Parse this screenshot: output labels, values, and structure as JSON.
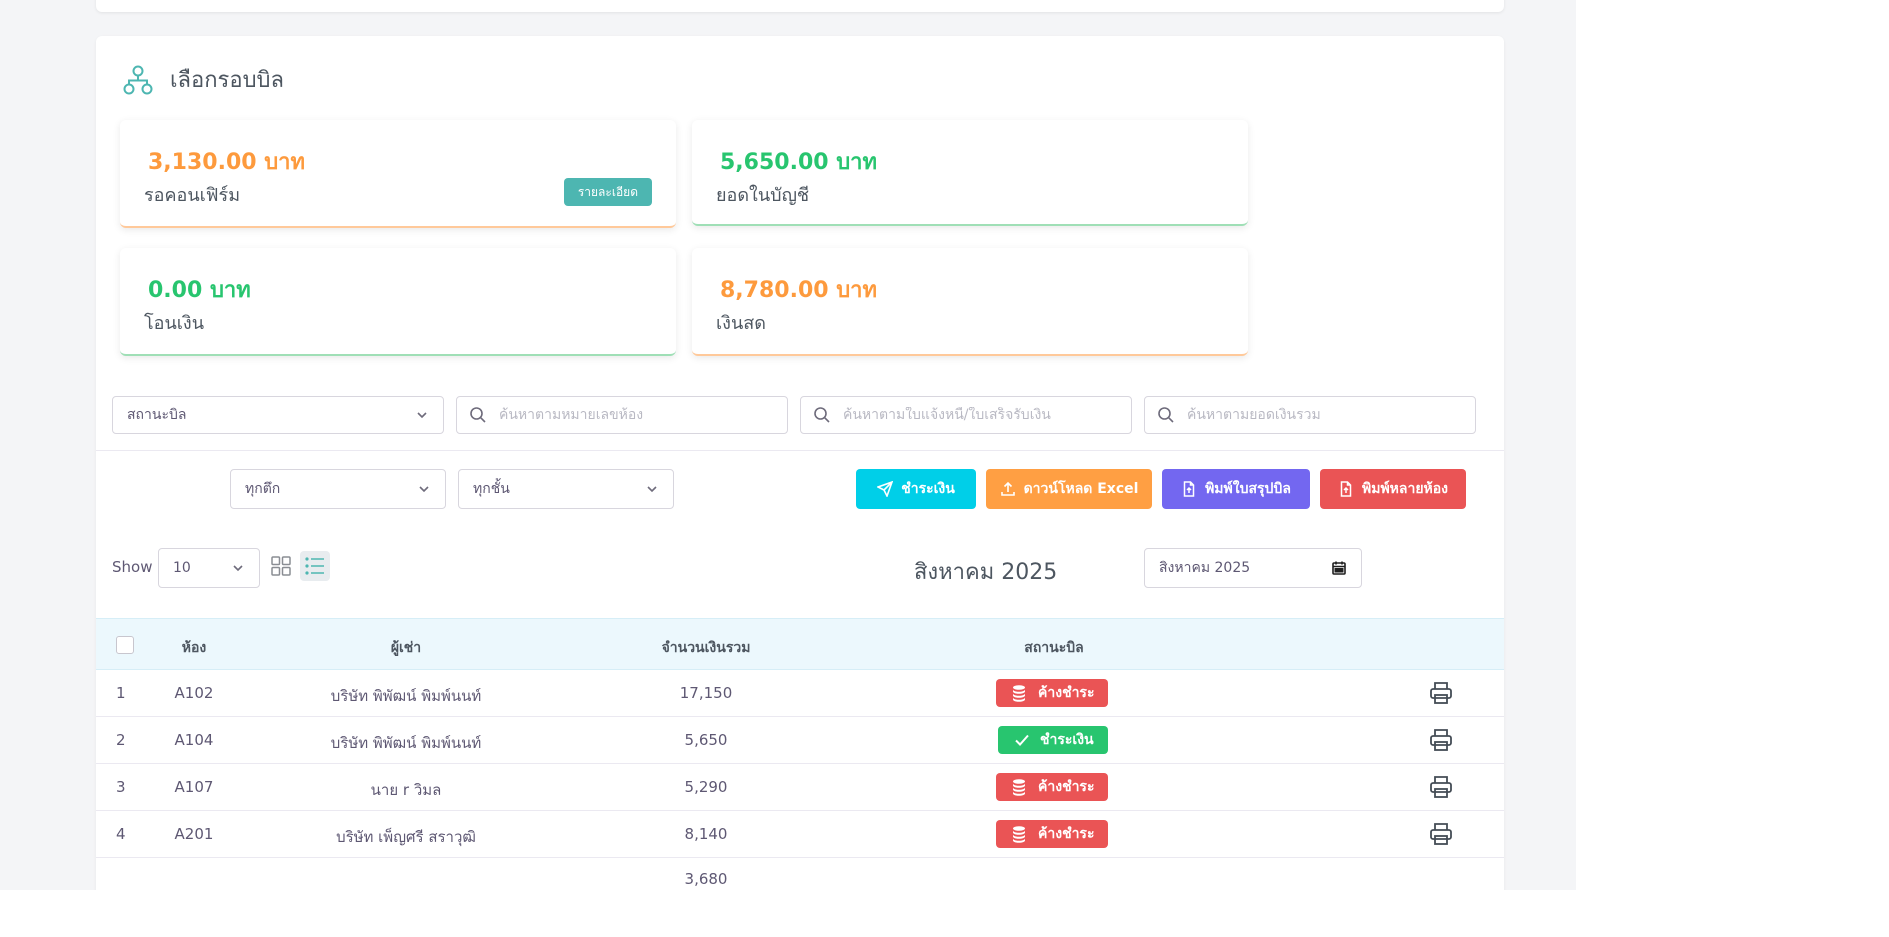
{
  "panel": {
    "title": "เลือกรอบบิล"
  },
  "stats": [
    {
      "amount": "3,130.00 บาท",
      "label": "รอคอนเฟิร์ม",
      "button": "รายละเอียด"
    },
    {
      "amount": "5,650.00 บาท",
      "label": "ยอดในบัญชี"
    },
    {
      "amount": "0.00 บาท",
      "label": "โอนเงิน"
    },
    {
      "amount": "8,780.00 บาท",
      "label": "เงินสด"
    }
  ],
  "filters": {
    "status_select": "สถานะบิล",
    "search_room_placeholder": "ค้นหาตามหมายเลขห้อง",
    "search_invoice_placeholder": "ค้นหาตามใบแจ้งหนี้/ใบเสร็จรับเงิน",
    "search_total_placeholder": "ค้นหาตามยอดเงินรวม",
    "building_select": "ทุกตึก",
    "floor_select": "ทุกชั้น"
  },
  "actions": {
    "pay": "ชำระเงิน",
    "download_excel": "ดาวน์โหลด Excel",
    "print_summary": "พิมพ์ใบสรุปบิล",
    "print_multi": "พิมพ์หลายห้อง"
  },
  "colors": {
    "pay": "#00cfe8",
    "download_excel": "#ff9f43",
    "print_summary": "#7367f0",
    "print_multi": "#ea5455",
    "accent": "#4db6b1"
  },
  "toolbar": {
    "show_label": "Show",
    "page_size": "10",
    "month_title": "สิงหาคม 2025",
    "date_value": "สิงหาคม 2025"
  },
  "table": {
    "headers": {
      "room": "ห้อง",
      "tenant": "ผู้เช่า",
      "total": "จำนวนเงินรวม",
      "status": "สถานะบิล"
    },
    "rows": [
      {
        "no": "1",
        "room": "A102",
        "tenant": "บริษัท พิพัฒน์ พิมพ์นนท์",
        "total": "17,150",
        "status": "ค้างชำระ",
        "status_type": "unpaid"
      },
      {
        "no": "2",
        "room": "A104",
        "tenant": "บริษัท พิพัฒน์ พิมพ์นนท์",
        "total": "5,650",
        "status": "ชำระเงิน",
        "status_type": "paid"
      },
      {
        "no": "3",
        "room": "A107",
        "tenant": "นาย r วิมล",
        "total": "5,290",
        "status": "ค้างชำระ",
        "status_type": "unpaid"
      },
      {
        "no": "4",
        "room": "A201",
        "tenant": "บริษัท เพ็ญศรี สราวุฒิ",
        "total": "8,140",
        "status": "ค้างชำระ",
        "status_type": "unpaid"
      },
      {
        "no": "",
        "room": "",
        "tenant": "",
        "total": "3,680",
        "status": "",
        "status_type": "pending"
      }
    ]
  }
}
